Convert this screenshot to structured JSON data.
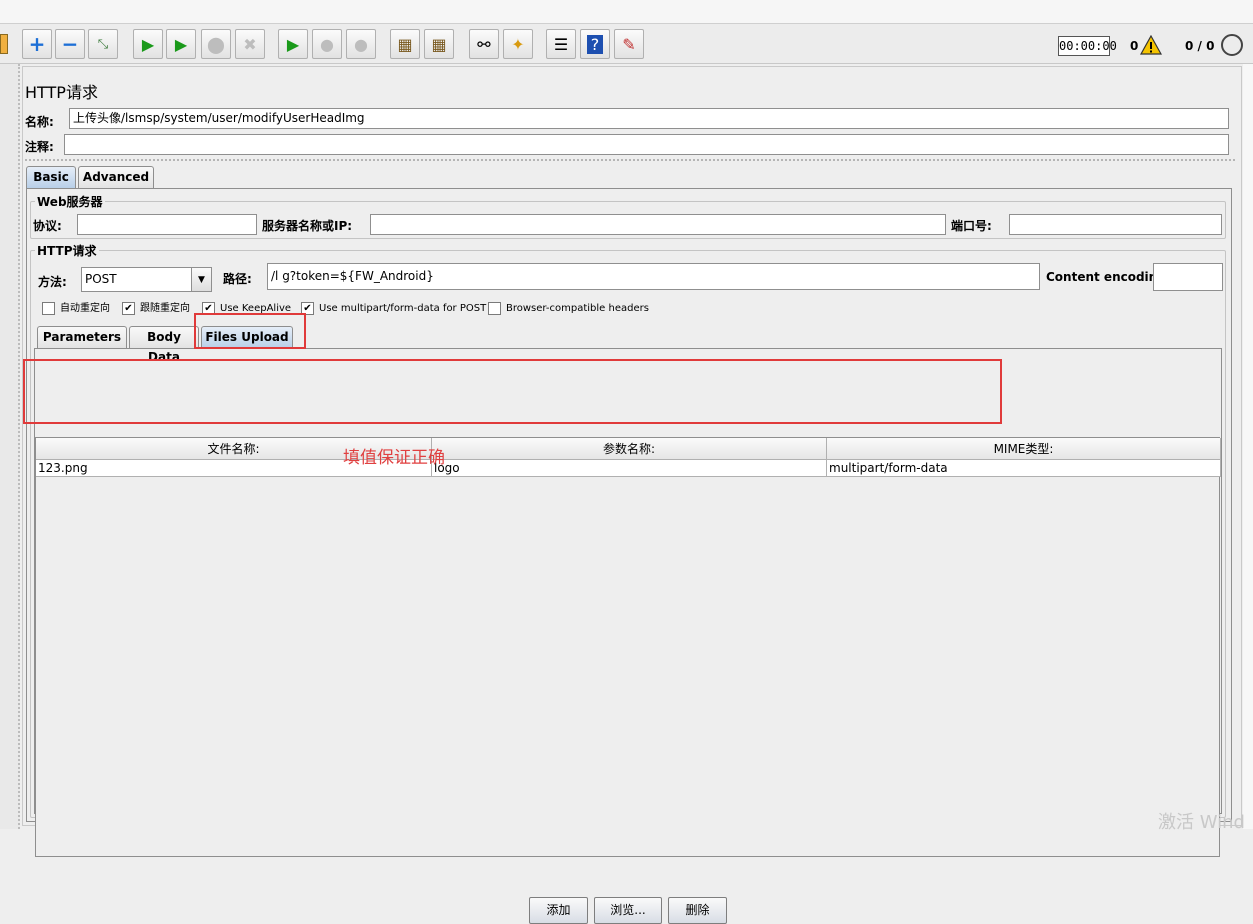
{
  "toolbar": {
    "timer": "00:00:00",
    "warning_count": "0",
    "thread_count": "0 / 0",
    "buttons": [
      "add-icon",
      "remove-icon",
      "toggle-icon",
      "start-icon",
      "start-no-pause-icon",
      "stop-icon",
      "shutdown-icon",
      "remote-start-icon",
      "remote-stop-icon",
      "remote-shutdown-icon",
      "clear-icon",
      "clear-all-icon",
      "search-icon",
      "reset-search-icon",
      "function-helper-icon",
      "help-icon",
      "ssl-manager-icon"
    ]
  },
  "panel": {
    "title": "HTTP请求",
    "name_label": "名称:",
    "name_value": "上传头像/lsmsp/system/user/modifyUserHeadImg",
    "comment_label": "注释:",
    "comment_value": "",
    "tabs": [
      "Basic",
      "Advanced"
    ],
    "web_server": {
      "group_title": "Web服务器",
      "protocol_label": "协议:",
      "protocol_value": "",
      "server_label": "服务器名称或IP:",
      "server_value": "",
      "port_label": "端口号:",
      "port_value": ""
    },
    "http_request": {
      "group_title": "HTTP请求",
      "method_label": "方法:",
      "method_value": "POST",
      "path_label": "路径:",
      "path_value": "/l                                   g?token=${FW_Android}",
      "encoding_label": "Content encoding:",
      "encoding_value": ""
    },
    "checkboxes": [
      {
        "label": "自动重定向",
        "checked": false
      },
      {
        "label": "跟随重定向",
        "checked": true
      },
      {
        "label": "Use KeepAlive",
        "checked": true
      },
      {
        "label": "Use multipart/form-data for POST",
        "checked": true
      },
      {
        "label": "Browser-compatible headers",
        "checked": false
      }
    ],
    "sub_tabs": [
      "Parameters",
      "Body Data",
      "Files Upload"
    ],
    "files_table": {
      "headers": [
        "文件名称:",
        "参数名称:",
        "MIME类型:"
      ],
      "rows": [
        [
          "123.png",
          "logo",
          "multipart/form-data"
        ]
      ]
    },
    "buttons": {
      "add": "添加",
      "browse": "浏览...",
      "delete": "删除"
    }
  },
  "annotation": "填值保证正确",
  "watermark": "激活 Wind",
  "colors": {
    "annotation": "#e04040",
    "active_tab": "#b8cfe8"
  }
}
